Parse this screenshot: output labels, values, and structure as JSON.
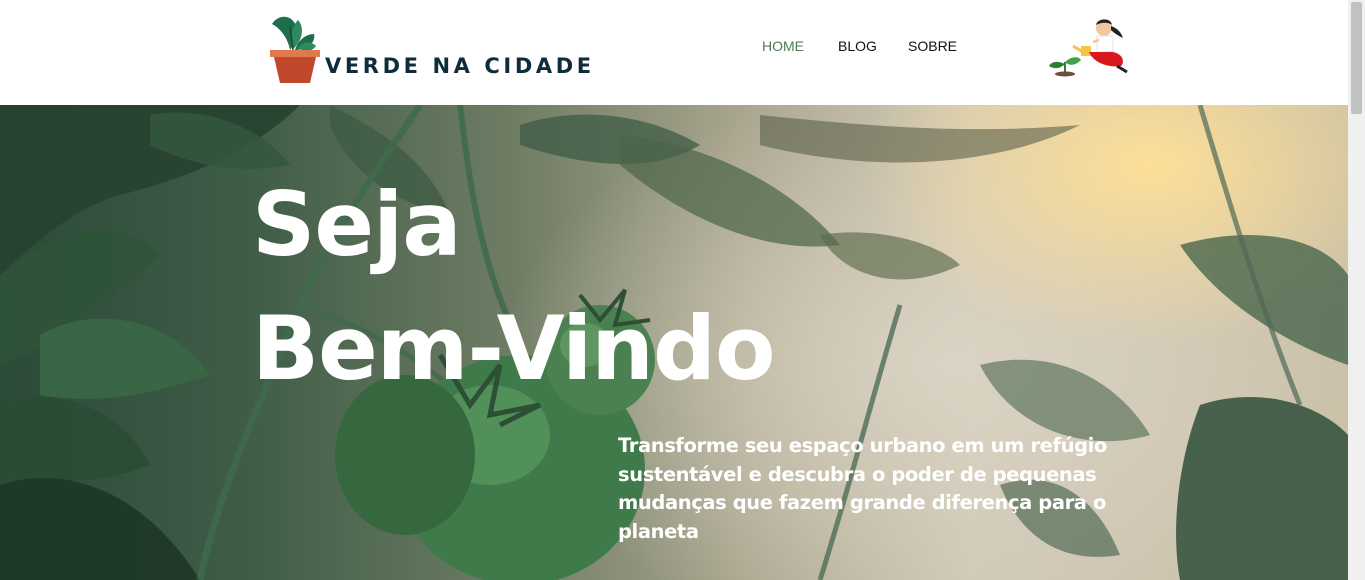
{
  "header": {
    "logo_text": "VERDE NA CIDADE",
    "nav": [
      {
        "label": "HOME",
        "active": true
      },
      {
        "label": "BLOG",
        "active": false
      },
      {
        "label": "SOBRE",
        "active": false
      }
    ]
  },
  "hero": {
    "title_line1": "Seja",
    "title_line2": "Bem-Vindo",
    "text": "Transforme seu espaço urbano em um refúgio sustentável e descubra o poder de pequenas mudanças que fazem grande diferença para o planeta"
  },
  "colors": {
    "brand_dark": "#0f2c3a",
    "nav_active": "#4e7c5a",
    "pot": "#c0492b",
    "leaf": "#1f6e4a"
  },
  "icons": [
    "plant-pot-logo-icon",
    "gardener-illustration-icon"
  ]
}
